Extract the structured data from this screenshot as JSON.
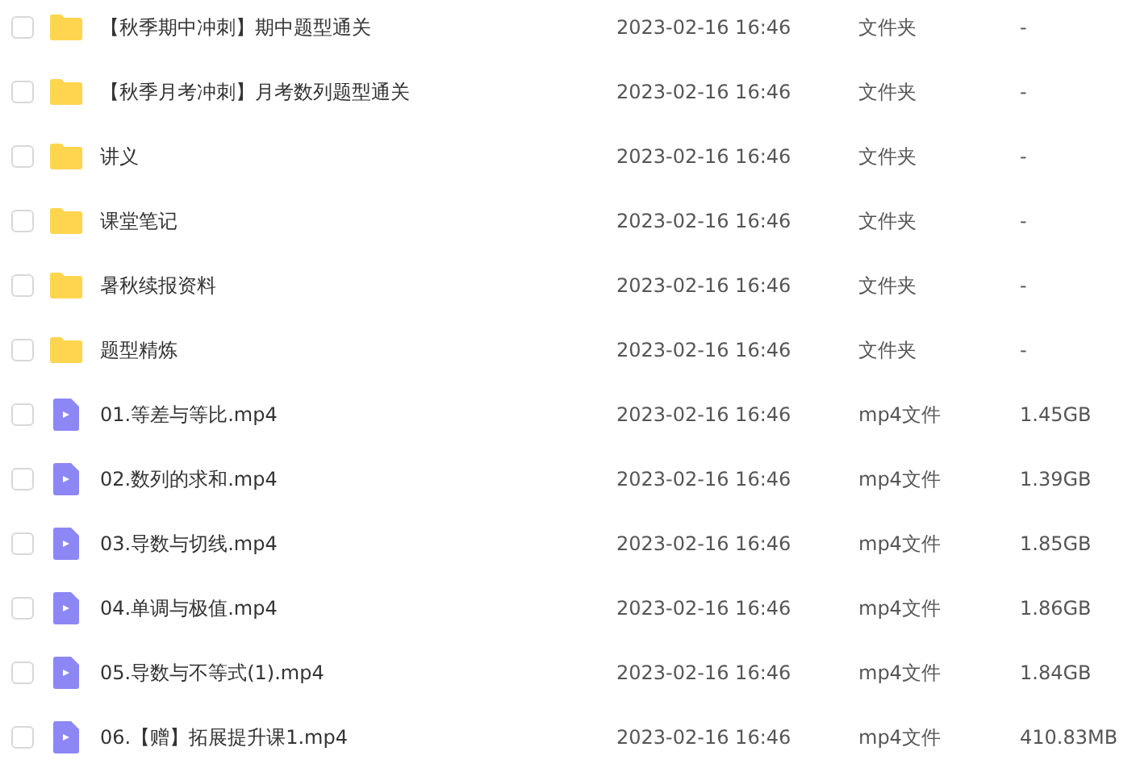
{
  "files": [
    {
      "kind": "folder",
      "checked": false,
      "name": "【秋季期中冲刺】期中题型通关",
      "modified": "2023-02-16 16:46",
      "type": "文件夹",
      "size": "-"
    },
    {
      "kind": "folder",
      "checked": false,
      "name": "【秋季月考冲刺】月考数列题型通关",
      "modified": "2023-02-16 16:46",
      "type": "文件夹",
      "size": "-"
    },
    {
      "kind": "folder",
      "checked": false,
      "name": "讲义",
      "modified": "2023-02-16 16:46",
      "type": "文件夹",
      "size": "-"
    },
    {
      "kind": "folder",
      "checked": false,
      "name": "课堂笔记",
      "modified": "2023-02-16 16:46",
      "type": "文件夹",
      "size": "-"
    },
    {
      "kind": "folder",
      "checked": false,
      "name": "暑秋续报资料",
      "modified": "2023-02-16 16:46",
      "type": "文件夹",
      "size": "-"
    },
    {
      "kind": "folder",
      "checked": false,
      "name": "题型精炼",
      "modified": "2023-02-16 16:46",
      "type": "文件夹",
      "size": "-"
    },
    {
      "kind": "video",
      "checked": false,
      "name": "01.等差与等比.mp4",
      "modified": "2023-02-16 16:46",
      "type": "mp4文件",
      "size": "1.45GB"
    },
    {
      "kind": "video",
      "checked": false,
      "name": "02.数列的求和.mp4",
      "modified": "2023-02-16 16:46",
      "type": "mp4文件",
      "size": "1.39GB"
    },
    {
      "kind": "video",
      "checked": false,
      "name": "03.导数与切线.mp4",
      "modified": "2023-02-16 16:46",
      "type": "mp4文件",
      "size": "1.85GB"
    },
    {
      "kind": "video",
      "checked": false,
      "name": "04.单调与极值.mp4",
      "modified": "2023-02-16 16:46",
      "type": "mp4文件",
      "size": "1.86GB"
    },
    {
      "kind": "video",
      "checked": false,
      "name": "05.导数与不等式(1).mp4",
      "modified": "2023-02-16 16:46",
      "type": "mp4文件",
      "size": "1.84GB"
    },
    {
      "kind": "video",
      "checked": false,
      "name": "06.【赠】拓展提升课1.mp4",
      "modified": "2023-02-16 16:46",
      "type": "mp4文件",
      "size": "410.83MB"
    }
  ]
}
